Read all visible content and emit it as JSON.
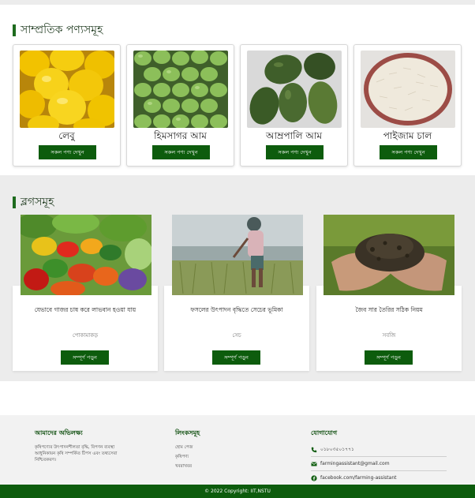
{
  "header": {
    "recent_products_title": "সাম্প্রতিক পণ্যসমূহ",
    "blogs_title": "ব্লগসমূহ"
  },
  "products": [
    {
      "name": "লেবু",
      "button": "সকল পণ্য দেখুন",
      "image": "lemons-image"
    },
    {
      "name": "হিমসাগর আম",
      "button": "সকল পণ্য দেখুন",
      "image": "green-mangoes-image"
    },
    {
      "name": "আম্রপালি আম",
      "button": "সকল পণ্য দেখুন",
      "image": "amrapali-mangoes-image"
    },
    {
      "name": "পাইজাম চাল",
      "button": "সকল পণ্য দেখুন",
      "image": "rice-image"
    }
  ],
  "blogs": [
    {
      "title": "যেভাবে গাজর চাষ করে লাভবান হওয়া যায়",
      "category": "পোকামাকড়",
      "button": "সম্পূর্ণ পড়ুন",
      "image": "vegetables-image"
    },
    {
      "title": "ফসলের উৎপাদন বৃদ্ধিতে সেচের ভূমিকা",
      "category": "সেচ",
      "button": "সম্পূর্ণ পড়ুন",
      "image": "farmer-irrigation-image"
    },
    {
      "title": "জৈব সার তৈরির সঠিক নিয়ম",
      "category": "সবজি",
      "button": "সম্পূর্ণ পড়ুন",
      "image": "organic-soil-image"
    }
  ],
  "footer": {
    "mission_title": "আমাদের অভিলক্ষ্য",
    "mission_text": "কৃষিপণ্যের উৎপাদনশীলতা বৃদ্ধি, বিপণন ব্যবস্থা আধুনিকায়ন কৃষি সম্পর্কিত টিপস এবং তথ্যসেবা নিশ্চিতকরণ।",
    "links_title": "লিংকসমূহ",
    "links": [
      "হোম পেজ",
      "কৃষিপণ্য",
      "খবরাখবর"
    ],
    "contact_title": "যোগাযোগ",
    "phone": "০১৮০৩৫০১৭৭১",
    "email": "farmingassistant@gmail.com",
    "facebook": "facebook.com/farming-assistant",
    "copyright": "© 2022 Copyright: IIT,NSTU"
  },
  "colors": {
    "brand_green": "#0d5c0d",
    "band_gray": "#ececec"
  }
}
